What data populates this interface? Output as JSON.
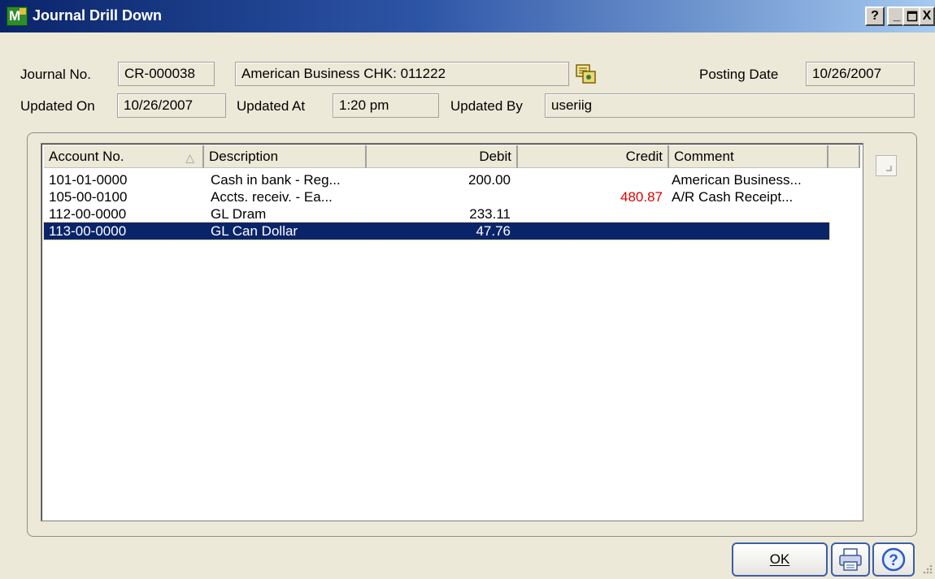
{
  "window": {
    "title": "Journal Drill Down",
    "controls": {
      "help": "?",
      "minimize": "_",
      "maximize": "□",
      "close": "X"
    }
  },
  "header": {
    "journal_no_label": "Journal No.",
    "journal_no": "CR-000038",
    "description": "American Business  CHK: 011222",
    "posting_date_label": "Posting Date",
    "posting_date": "10/26/2007",
    "updated_on_label": "Updated On",
    "updated_on": "10/26/2007",
    "updated_at_label": "Updated At",
    "updated_at": "1:20 pm",
    "updated_by_label": "Updated By",
    "updated_by": "useriig"
  },
  "grid": {
    "columns": {
      "account_no": "Account No.",
      "description": "Description",
      "debit": "Debit",
      "credit": "Credit",
      "comment": "Comment"
    },
    "rows": [
      {
        "account_no": "101-01-0000",
        "description": "Cash in bank - Reg...",
        "debit": "200.00",
        "credit": "",
        "comment": "American Business..."
      },
      {
        "account_no": "105-00-0100",
        "description": "Accts. receiv. - Ea...",
        "debit": "",
        "credit": "480.87",
        "comment": "A/R Cash Receipt..."
      },
      {
        "account_no": "112-00-0000",
        "description": "GL Dram",
        "debit": "233.11",
        "credit": "",
        "comment": ""
      },
      {
        "account_no": "113-00-0000",
        "description": "GL Can Dollar",
        "debit": "47.76",
        "credit": "",
        "comment": ""
      }
    ],
    "selected_row": 3
  },
  "buttons": {
    "ok_label": "OK"
  },
  "icons": {
    "app": "mas90-app-icon",
    "lookup": "lookup-icon",
    "print": "printer-icon",
    "help": "help-icon",
    "sort": "sort-ascending-icon"
  },
  "colors": {
    "title_bar_start": "#0a246a",
    "title_bar_end": "#a6caf0",
    "selection": "#0a246a",
    "credit_text": "#e00000"
  }
}
